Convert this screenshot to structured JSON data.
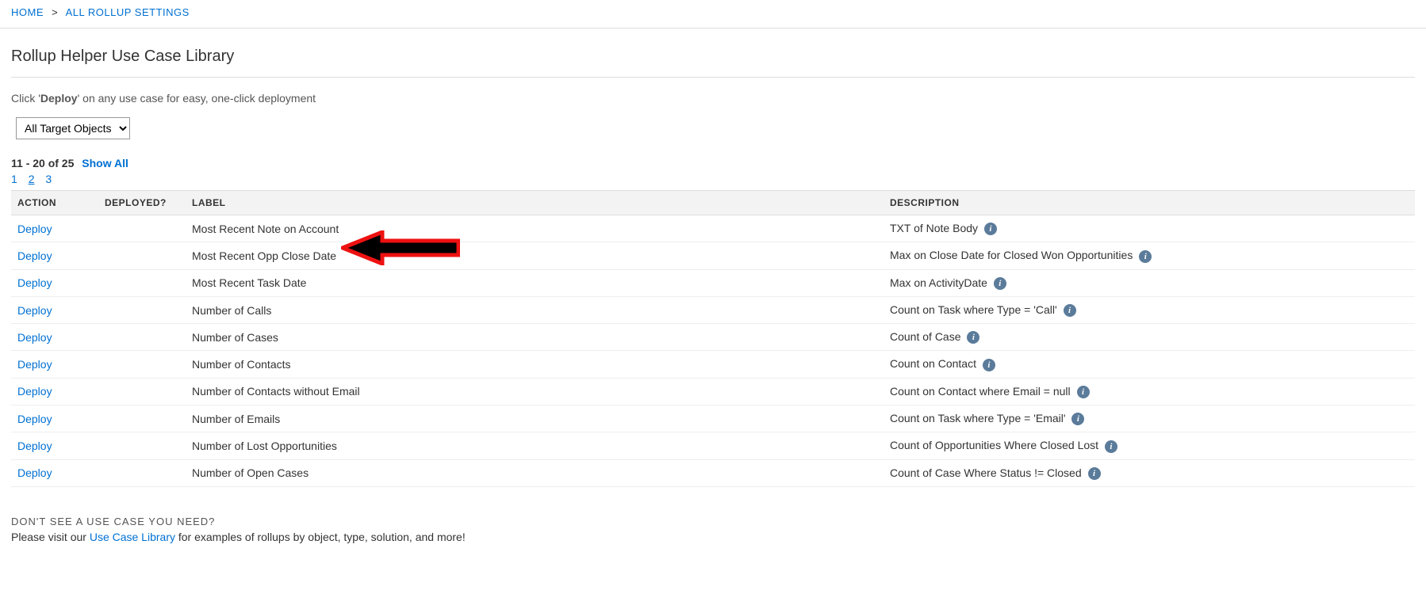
{
  "breadcrumbs": {
    "home": "HOME",
    "all_settings": "ALL ROLLUP SETTINGS",
    "sep": ">"
  },
  "title": "Rollup Helper Use Case Library",
  "instruction_prefix": "Click '",
  "instruction_bold": "Deploy",
  "instruction_suffix": "' on any use case for easy, one-click deployment",
  "filter_selected": "All Target Objects",
  "pager": {
    "range": "11 - 20 of 25",
    "show_all": "Show All",
    "p1": "1",
    "p2": "2",
    "p3": "3"
  },
  "headers": {
    "action": "ACTION",
    "deployed": "DEPLOYED?",
    "label": "LABEL",
    "description": "DESCRIPTION"
  },
  "deploy_label": "Deploy",
  "rows": [
    {
      "label": "Most Recent Note on Account",
      "desc": "TXT of Note Body"
    },
    {
      "label": "Most Recent Opp Close Date",
      "desc": "Max on Close Date for Closed Won Opportunities"
    },
    {
      "label": "Most Recent Task Date",
      "desc": "Max on ActivityDate"
    },
    {
      "label": "Number of Calls",
      "desc": "Count on Task where Type = 'Call'"
    },
    {
      "label": "Number of Cases",
      "desc": "Count of Case"
    },
    {
      "label": "Number of Contacts",
      "desc": "Count on Contact"
    },
    {
      "label": "Number of Contacts without Email",
      "desc": "Count on Contact where Email = null"
    },
    {
      "label": "Number of Emails",
      "desc": "Count on Task where Type = 'Email'"
    },
    {
      "label": "Number of Lost Opportunities",
      "desc": "Count of Opportunities Where Closed Lost"
    },
    {
      "label": "Number of Open Cases",
      "desc": "Count of Case Where Status != Closed"
    }
  ],
  "footer": {
    "heading": "DON'T SEE A USE CASE YOU NEED?",
    "text_prefix": "Please visit our ",
    "link": "Use Case Library",
    "text_suffix": " for examples of rollups by object, type, solution, and more!"
  }
}
